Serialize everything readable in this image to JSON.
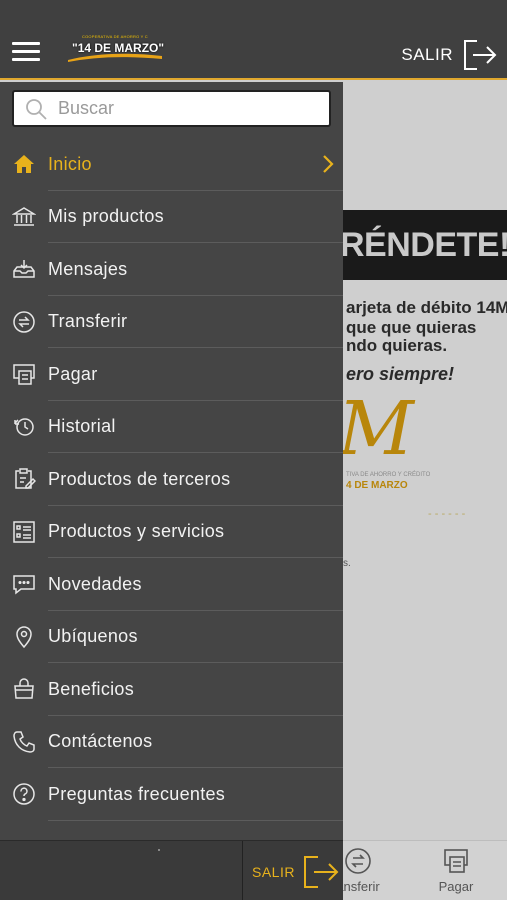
{
  "header": {
    "logo_small": "COOPERATIVA DE AHORRO Y CRÉDITO",
    "logo_main": "\"14 DE MARZO\"",
    "logout_label": "SALIR"
  },
  "search": {
    "placeholder": "Buscar",
    "value": ""
  },
  "menu": {
    "items": [
      {
        "label": "Inicio",
        "icon": "home-icon"
      },
      {
        "label": "Mis productos",
        "icon": "bank-icon"
      },
      {
        "label": "Mensajes",
        "icon": "inbox-icon"
      },
      {
        "label": "Transferir",
        "icon": "transfer-icon"
      },
      {
        "label": "Pagar",
        "icon": "payment-icon"
      },
      {
        "label": "Historial",
        "icon": "history-icon"
      },
      {
        "label": "Productos de terceros",
        "icon": "clipboard-edit-icon"
      },
      {
        "label": "Productos y servicios",
        "icon": "list-icon"
      },
      {
        "label": "Novedades",
        "icon": "chat-icon"
      },
      {
        "label": "Ubíquenos",
        "icon": "location-pin-icon"
      },
      {
        "label": "Beneficios",
        "icon": "bag-icon"
      },
      {
        "label": "Contáctenos",
        "icon": "phone-icon"
      },
      {
        "label": "Preguntas frecuentes",
        "icon": "question-icon"
      }
    ]
  },
  "drawer_footer": {
    "logout_label": "SALIR"
  },
  "background": {
    "banner": "RÉNDETE!",
    "promo_lines": [
      "arjeta de débito 14M",
      "que que quieras",
      "ndo quieras."
    ],
    "promo_italic": "ero siempre!",
    "promo_logo": "M",
    "promo_coop": "TIVA DE AHORRO Y CRÉDITO",
    "promo_coop_name": "4 DE MARZO"
  },
  "bottom_nav": {
    "transferir": "ansferir",
    "pagar": "Pagar"
  },
  "colors": {
    "accent": "#e8b21c",
    "drawer_bg": "#454545",
    "topbar_bg": "#404040"
  }
}
